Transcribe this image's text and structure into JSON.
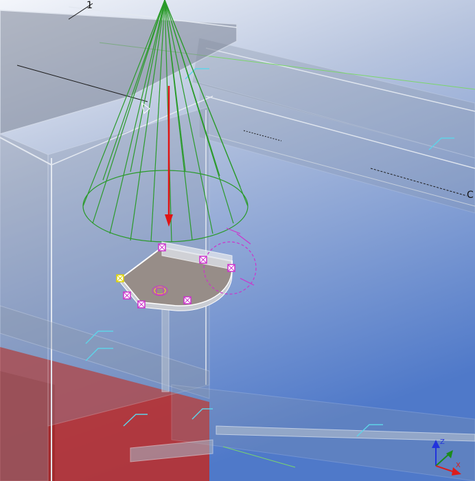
{
  "viewport": {
    "grid_labels": {
      "top": "1",
      "right": "C"
    },
    "axis_triad": {
      "z_label": "Z",
      "x_label": "X"
    },
    "colors": {
      "background_top": "#f4f6fb",
      "background_bottom": "#4f79c9",
      "ghost_structure": "#8e9aad",
      "section_red": "#b83030",
      "cone": "#2a9a2a",
      "direction_arrow": "#e01414",
      "plate": "#978d88",
      "handle_magenta": "#cc33cc",
      "handle_yellow": "#e0d400",
      "axis_z": "#2233dd",
      "axis_y": "#1b8c1b",
      "axis_x": "#dd1b1b"
    }
  }
}
